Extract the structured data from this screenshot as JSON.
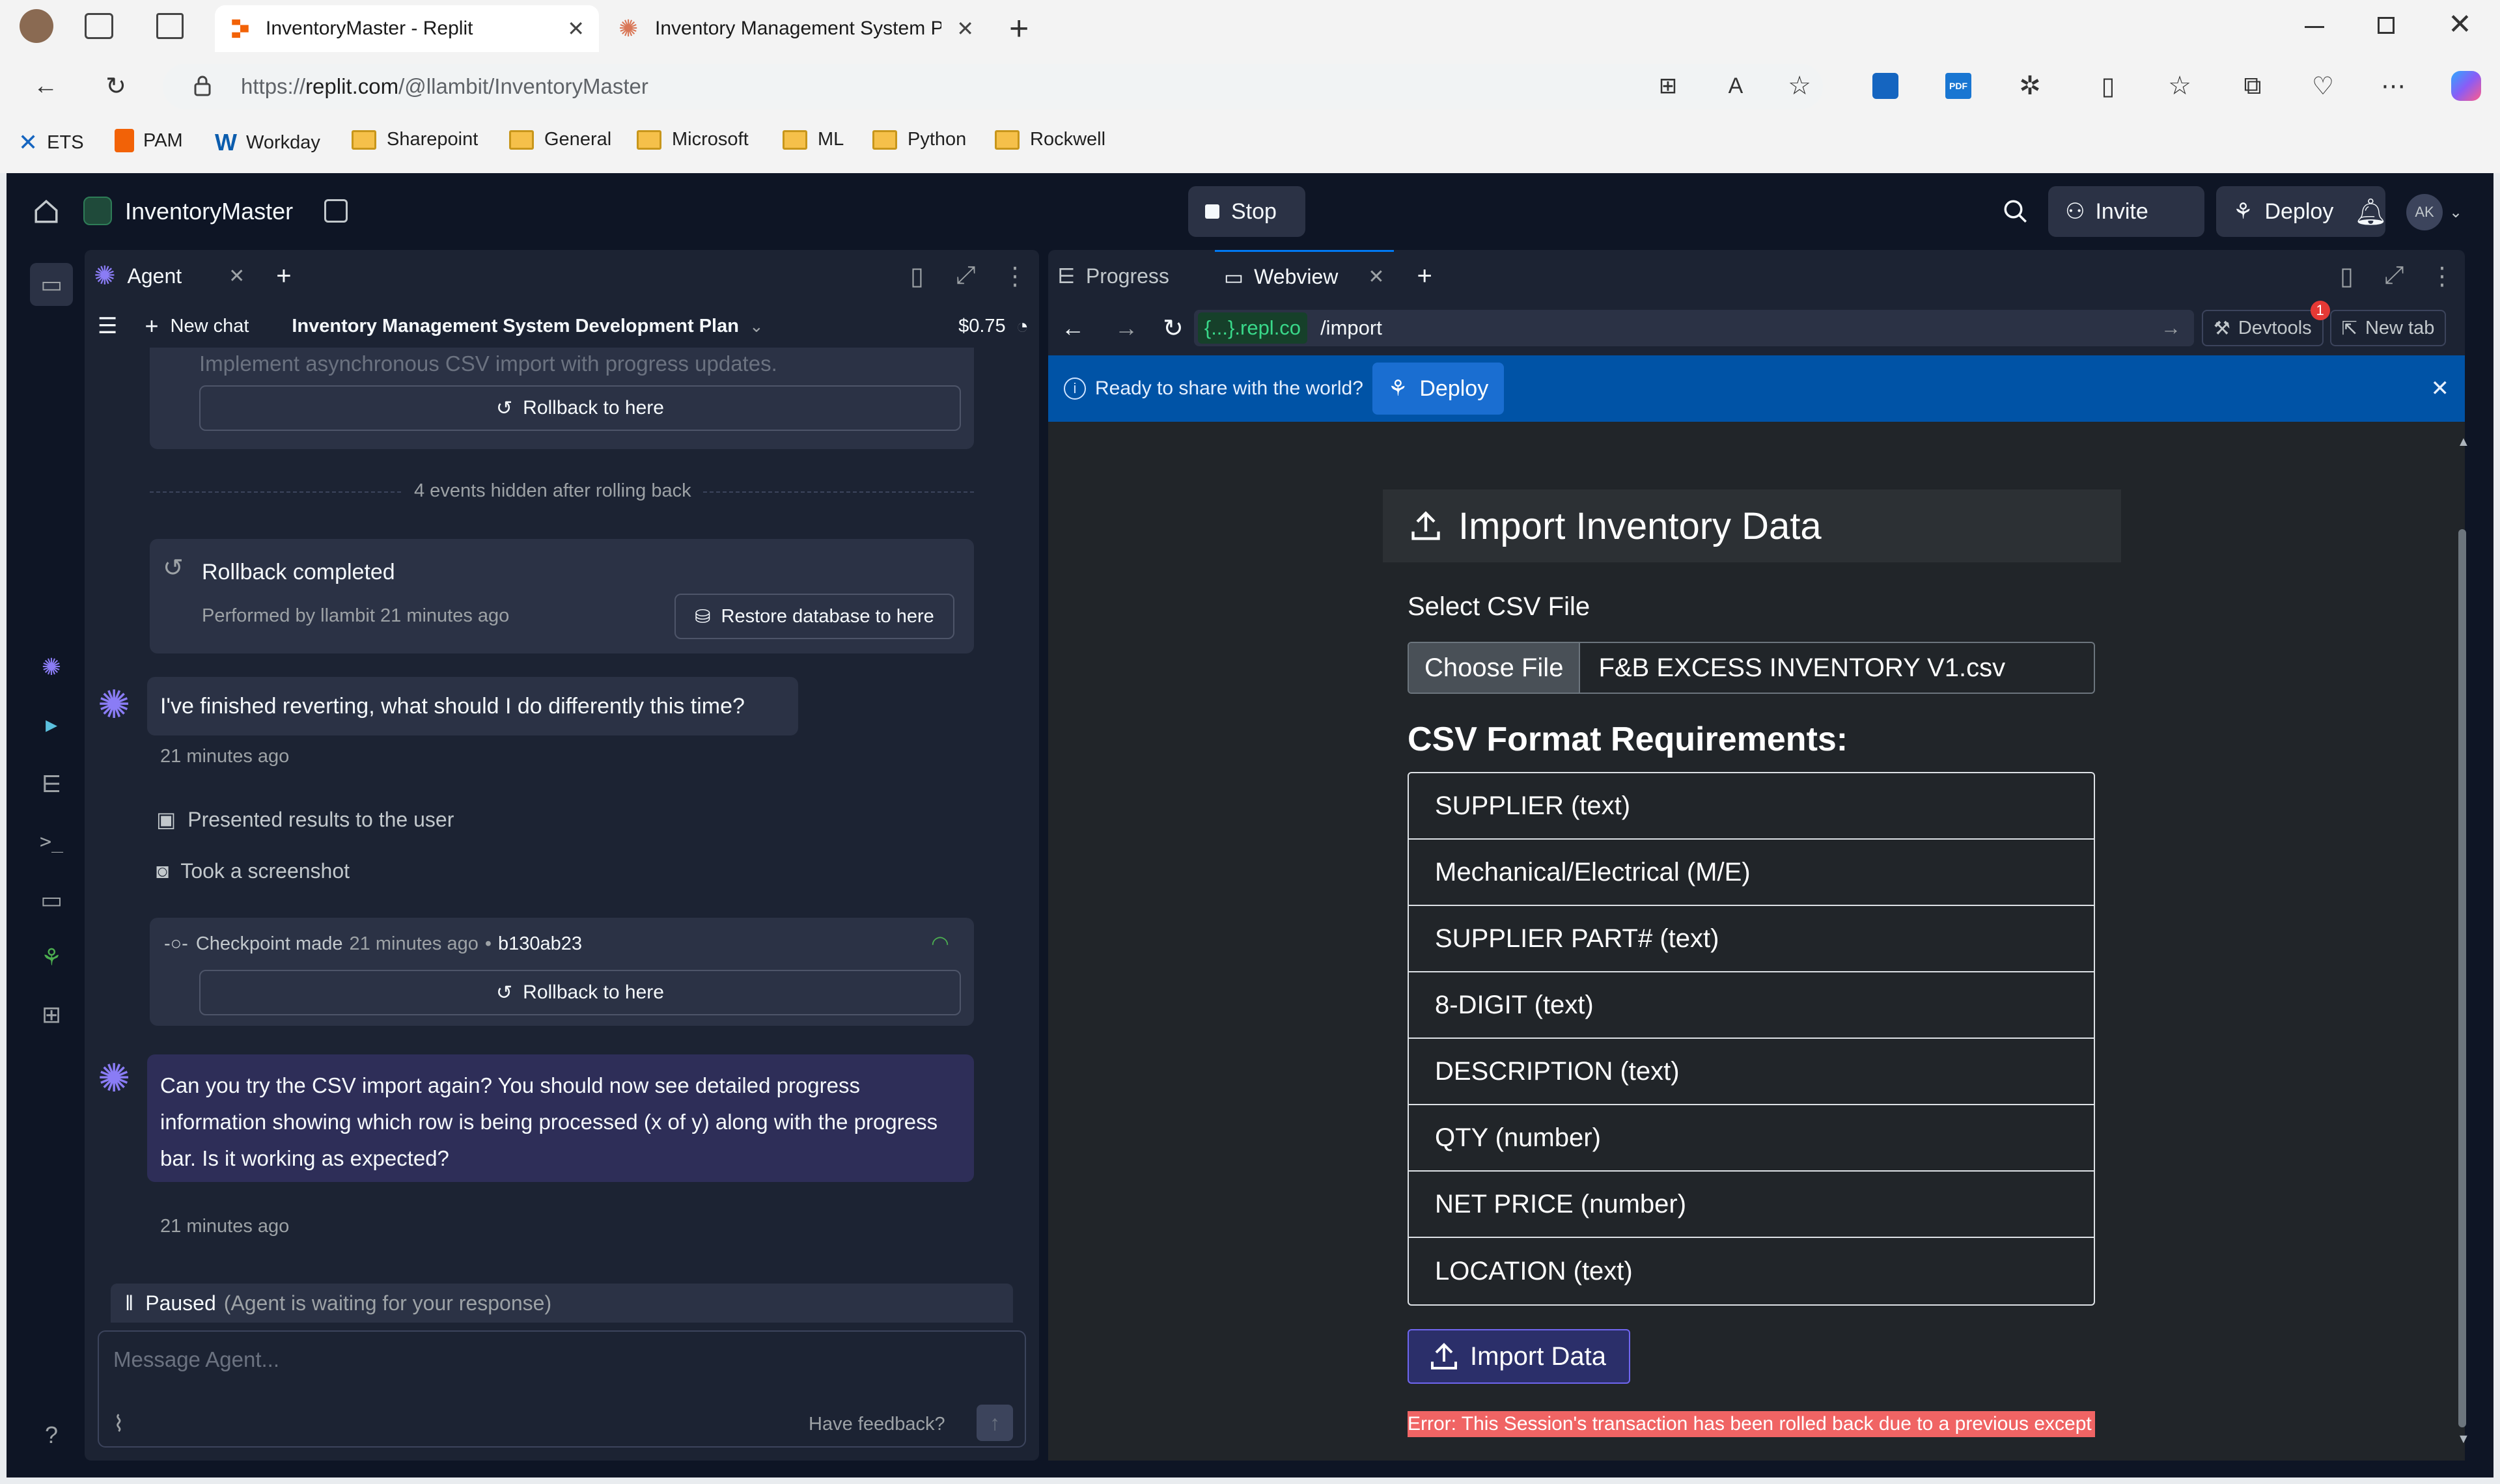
{
  "browser": {
    "tabs": [
      {
        "title": "InventoryMaster - Replit",
        "active": true
      },
      {
        "title": "Inventory Management System P",
        "active": false
      }
    ],
    "url_prefix": "https://",
    "url_host": "replit.com",
    "url_path": "/@llambit/InventoryMaster",
    "bookmarks": [
      "ETS",
      "PAM",
      "Workday",
      "Sharepoint",
      "General",
      "Microsoft",
      "ML",
      "Python",
      "Rockwell"
    ]
  },
  "app": {
    "project_name": "InventoryMaster",
    "stop_label": "Stop",
    "invite_label": "Invite",
    "deploy_label": "Deploy",
    "avatar_initials": "AK"
  },
  "agent": {
    "tab_label": "Agent",
    "new_chat_label": "New chat",
    "chat_title": "Inventory Management System Development Plan",
    "cost": "$0.75",
    "faded_text": "Implement asynchronous CSV import with progress updates.",
    "rollback_label": "Rollback to here",
    "events_hidden": "4 events hidden after rolling back",
    "rollback_completed": "Rollback completed",
    "performed_by": "Performed by llambit",
    "performed_time": "21 minutes ago",
    "restore_db_label": "Restore database to here",
    "msg1": "I've finished reverting, what should I do differently this time?",
    "msg1_time": "21 minutes ago",
    "action1": "Presented results to the user",
    "action2": "Took a screenshot",
    "checkpoint_label": "Checkpoint made",
    "checkpoint_time": "21 minutes ago",
    "checkpoint_bullet": "•",
    "checkpoint_hash": "b130ab23",
    "msg2": "Can you try the CSV import again? You should now see detailed progress information showing which row is being processed (x of y) along with the progress bar. Is it working as expected?",
    "msg2_time": "21 minutes ago",
    "paused_label": "Paused",
    "paused_detail": "(Agent is waiting for your response)",
    "input_placeholder": "Message Agent...",
    "feedback_label": "Have feedback?"
  },
  "webpanel": {
    "tab_progress": "Progress",
    "tab_webview": "Webview",
    "domain_badge": "{...}.repl.co",
    "path": "/import",
    "devtools_label": "Devtools",
    "devtools_badge": "1",
    "new_tab_label": "New tab",
    "banner_text": "Ready to share with the world?",
    "banner_deploy": "Deploy"
  },
  "import_page": {
    "title": "Import Inventory Data",
    "select_label": "Select CSV File",
    "choose_file": "Choose File",
    "file_name": "F&B EXCESS INVENTORY V1.csv",
    "requirements_title": "CSV Format Requirements:",
    "requirements": [
      "SUPPLIER (text)",
      "Mechanical/Electrical (M/E)",
      "SUPPLIER PART# (text)",
      "8-DIGIT (text)",
      "DESCRIPTION (text)",
      "QTY (number)",
      "NET PRICE (number)",
      "LOCATION (text)"
    ],
    "import_button": "Import Data",
    "error_text": "Error: This Session's transaction has been rolled back due to a previous except"
  },
  "colors": {
    "app_bg": "#0e1525",
    "panel_bg": "#1c2333",
    "card_bg": "#2b3245",
    "banner_bg": "#0053a6",
    "error_bg": "#dc3545",
    "agent_purple": "#8a7cf5"
  }
}
